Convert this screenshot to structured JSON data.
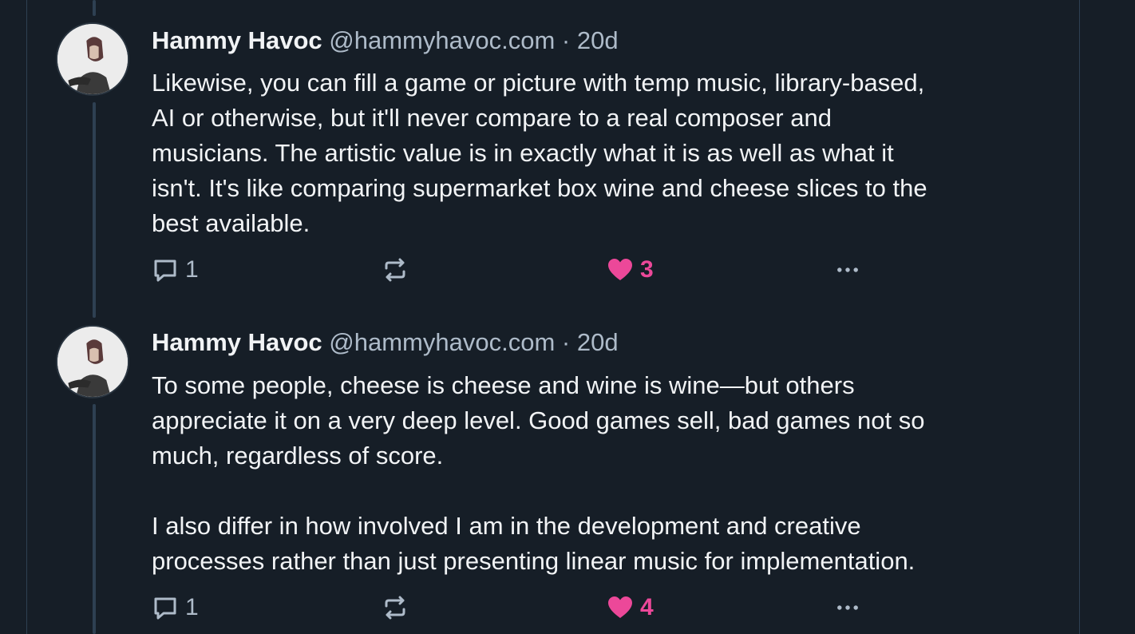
{
  "colors": {
    "background": "#161e27",
    "text": "#f1f3f5",
    "muted": "#aebbc9",
    "like": "#ec4899",
    "thread_line": "#2e4052"
  },
  "posts": [
    {
      "author": "Hammy Havoc",
      "handle": "@hammyhavoc.com",
      "separator": "·",
      "age": "20d",
      "text": "Likewise, you can fill a game or picture with temp music, library-based,\nAI or otherwise, but it'll never compare to a real composer and\nmusicians. The artistic value is in exactly what it is as well as what it\nisn't. It's like comparing supermarket box wine and cheese slices to the\nbest available.",
      "reply_count": "1",
      "like_count": "3",
      "icons": {
        "reply": "reply-icon",
        "repost": "repost-icon",
        "like": "heart-icon",
        "more": "more-icon"
      }
    },
    {
      "author": "Hammy Havoc",
      "handle": "@hammyhavoc.com",
      "separator": "·",
      "age": "20d",
      "text": "To some people, cheese is cheese and wine is wine—but others\nappreciate it on a very deep level. Good games sell, bad games not so\nmuch, regardless of score.\n\nI also differ in how involved I am in the development and creative\nprocesses rather than just presenting linear music for implementation.",
      "reply_count": "1",
      "like_count": "4",
      "icons": {
        "reply": "reply-icon",
        "repost": "repost-icon",
        "like": "heart-icon",
        "more": "more-icon"
      }
    }
  ]
}
